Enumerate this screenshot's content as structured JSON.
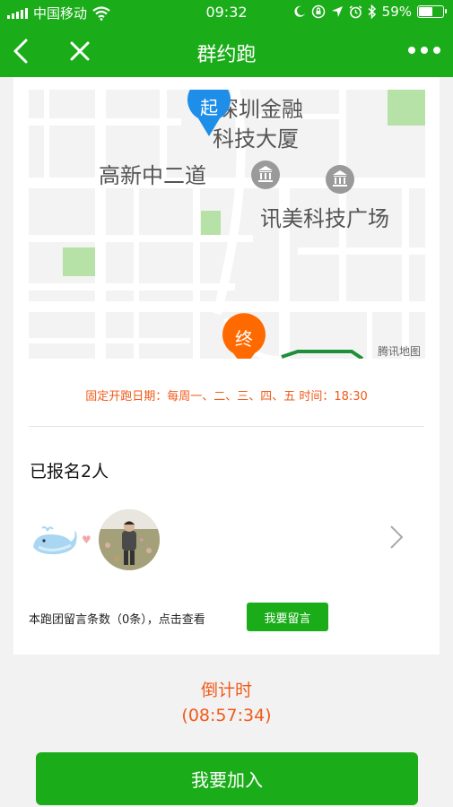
{
  "status_bar": {
    "carrier": "中国移动",
    "time": "09:32",
    "battery_percent_label": "59%",
    "battery_level": 0.59
  },
  "nav": {
    "title": "群约跑"
  },
  "map": {
    "start_marker": "起",
    "end_marker": "终",
    "labels": {
      "building1_line1": "深圳金融",
      "building1_line2": "科技大厦",
      "road": "高新中二道",
      "plaza": "讯美科技广场",
      "watermark": "腾讯地图"
    }
  },
  "schedule_text": "固定开跑日期：每周一、二、三、四、五 时间：18:30",
  "enrolled_text": "已报名2人",
  "message": {
    "text": "本跑团留言条数（0条），点击查看",
    "button": "我要留言"
  },
  "countdown": {
    "label": "倒计时",
    "time": "(08:57:34)"
  },
  "join_button": "我要加入",
  "colors": {
    "brand_green": "#1aad19",
    "accent_orange": "#f05a1a",
    "marker_blue": "#1e8ee8"
  }
}
